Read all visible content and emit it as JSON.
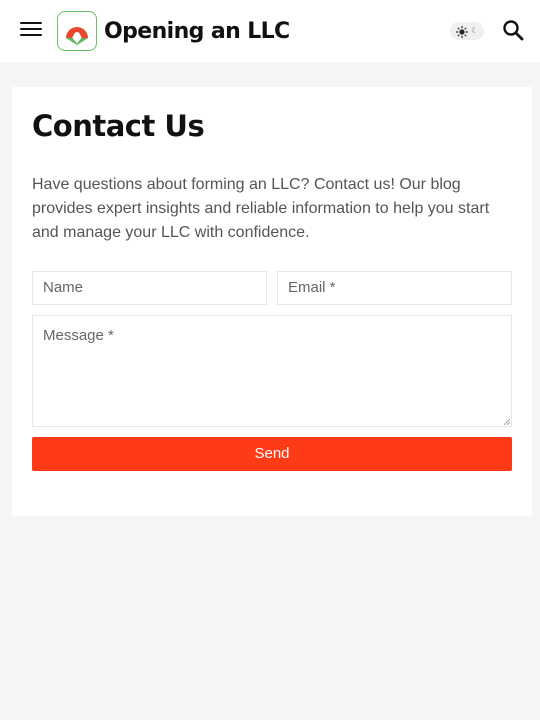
{
  "header": {
    "menu_icon": "hamburger-menu-icon",
    "logo_icon": "logo-arch-icon",
    "site_name": "Opening an LLC",
    "theme_toggle": {
      "light_icon": "sun-icon",
      "dark_icon": "moon-icon",
      "moon_glyph": "☾"
    },
    "search_icon": "search-icon"
  },
  "main": {
    "title": "Contact Us",
    "intro": "Have questions about forming an LLC? Contact us! Our blog provides expert insights and reliable information to help you start and manage your LLC with confidence.",
    "form": {
      "name_placeholder": "Name",
      "email_placeholder": "Email *",
      "message_placeholder": "Message *",
      "submit_label": "Send"
    }
  },
  "colors": {
    "page_background": "#f4f5f7",
    "accent": "#ff3b17",
    "logo_green": "#5cb85c",
    "logo_red": "#e8472c",
    "heading": "#111111",
    "body_text": "#555555"
  }
}
